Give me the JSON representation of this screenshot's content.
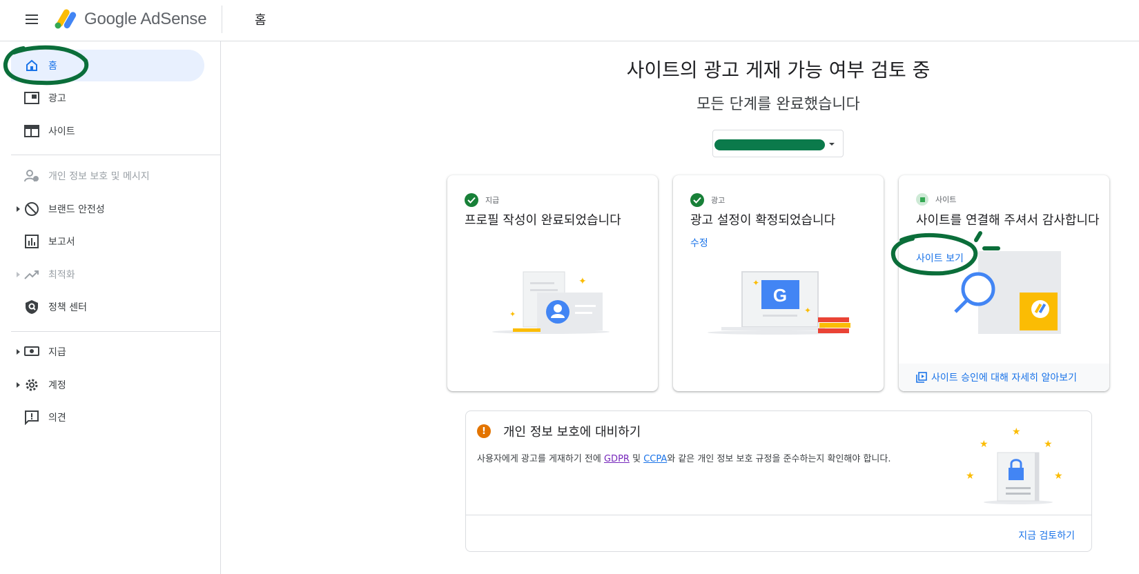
{
  "header": {
    "app_name": "Google AdSense",
    "page_title": "홈"
  },
  "sidebar": {
    "items": [
      {
        "label": "홈",
        "icon": "home-icon"
      },
      {
        "label": "광고",
        "icon": "ads-icon"
      },
      {
        "label": "사이트",
        "icon": "sites-icon"
      },
      {
        "label": "개인 정보 보호 및 메시지",
        "icon": "privacy-messaging-icon"
      },
      {
        "label": "브랜드 안전성",
        "icon": "block-icon"
      },
      {
        "label": "보고서",
        "icon": "reports-icon"
      },
      {
        "label": "최적화",
        "icon": "trending-icon"
      },
      {
        "label": "정책 센터",
        "icon": "policy-shield-icon"
      },
      {
        "label": "지급",
        "icon": "payments-icon"
      },
      {
        "label": "계정",
        "icon": "gear-icon"
      },
      {
        "label": "의견",
        "icon": "feedback-icon"
      }
    ]
  },
  "main": {
    "title": "사이트의 광고 게재 가능 여부 검토 중",
    "subtitle": "모든 단계를 완료했습니다",
    "site_selector": {
      "value_redacted": true,
      "color": "#0b7a4b"
    }
  },
  "cards": [
    {
      "kicker": "지급",
      "title": "프로필 작성이 완료되었습니다",
      "status": "complete"
    },
    {
      "kicker": "광고",
      "title": "광고 설정이 확정되었습니다",
      "link": "수정",
      "status": "complete"
    },
    {
      "kicker": "사이트",
      "title": "사이트를 연결해 주셔서 감사합니다",
      "link": "사이트 보기",
      "footer": "사이트 승인에 대해 자세히 알아보기",
      "status": "in-progress"
    }
  ],
  "privacy": {
    "title": "개인 정보 보호에 대비하기",
    "desc_before": "사용자에게 광고를 게재하기 전에 ",
    "gdpr": "GDPR",
    "and": " 및 ",
    "ccpa": "CCPA",
    "desc_after": "와 같은 개인 정보 보호 규정을 준수하는지 확인해야 합니다.",
    "action": "지금 검토하기"
  },
  "colors": {
    "accent": "#1a73e8",
    "active_bg": "#e8f0fe",
    "success": "#188038",
    "warning": "#e37400",
    "annotation": "#0b6e3a"
  }
}
